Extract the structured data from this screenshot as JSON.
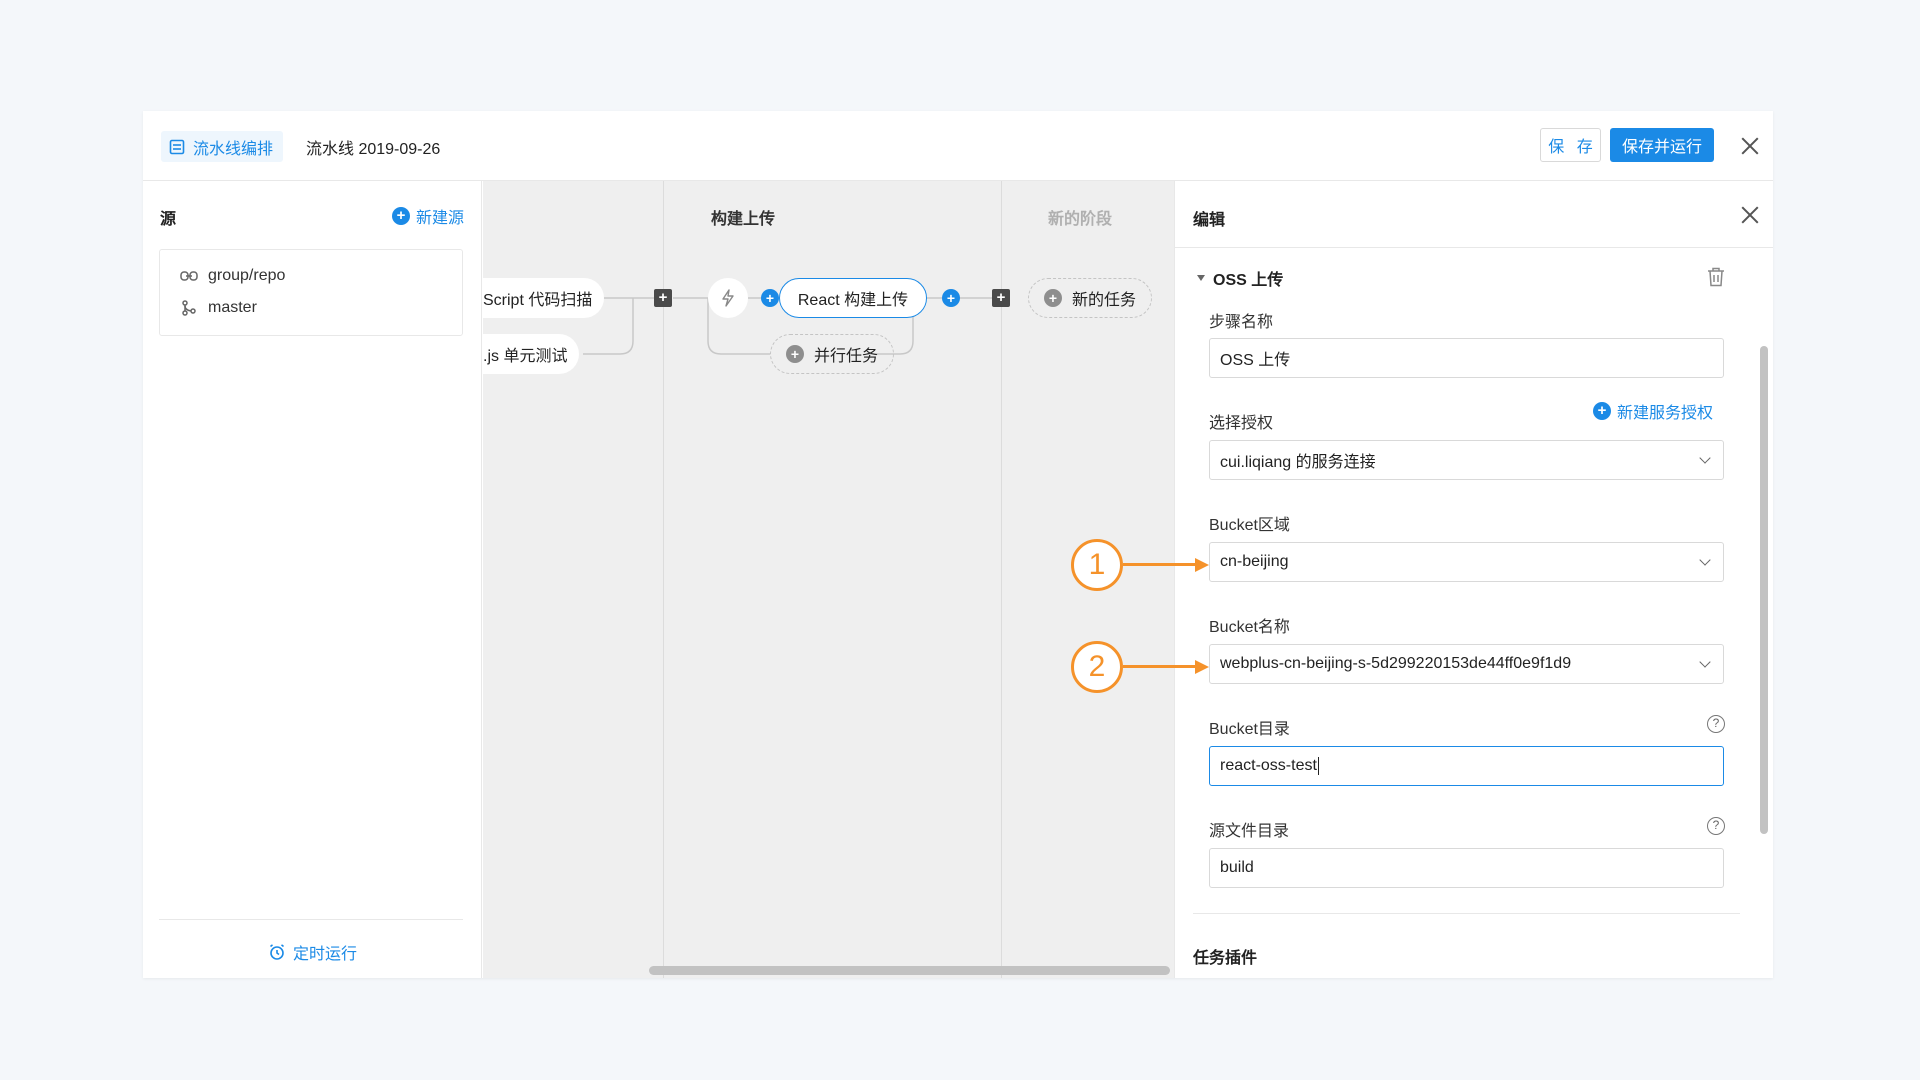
{
  "header": {
    "tag_label": "流水线编排",
    "pipeline_name": "流水线 2019-09-26",
    "save_label": "保 存",
    "save_run_label": "保存并运行"
  },
  "source_panel": {
    "title": "源",
    "add_label": "新建源",
    "repo": "group/repo",
    "branch": "master",
    "timer_label": "定时运行"
  },
  "canvas": {
    "stages": [
      {
        "title": "构建上传"
      },
      {
        "title": "新的阶段"
      }
    ],
    "tasks": {
      "scan": "Script 代码扫描",
      "unit_test": ".js 单元测试",
      "react_build": "React 构建上传",
      "parallel": "并行任务",
      "new_task": "新的任务"
    }
  },
  "editor": {
    "title": "编辑",
    "section_title": "OSS 上传",
    "step_name_label": "步骤名称",
    "step_name_value": "OSS 上传",
    "auth_label": "选择授权",
    "auth_add_label": "新建服务授权",
    "auth_value": "cui.liqiang 的服务连接",
    "bucket_region_label": "Bucket区域",
    "bucket_region_value": "cn-beijing",
    "bucket_name_label": "Bucket名称",
    "bucket_name_value": "webplus-cn-beijing-s-5d299220153de44ff0e9f1d9",
    "bucket_dir_label": "Bucket目录",
    "bucket_dir_value": "react-oss-test",
    "src_dir_label": "源文件目录",
    "src_dir_value": "build",
    "plugins_title": "任务插件"
  },
  "annotations": {
    "callout_1": "1",
    "callout_2": "2",
    "color": "#f5922a"
  },
  "colors": {
    "accent": "#1b8ae6",
    "canvas_bg": "#efefef",
    "page_bg": "#f4f7fa"
  }
}
